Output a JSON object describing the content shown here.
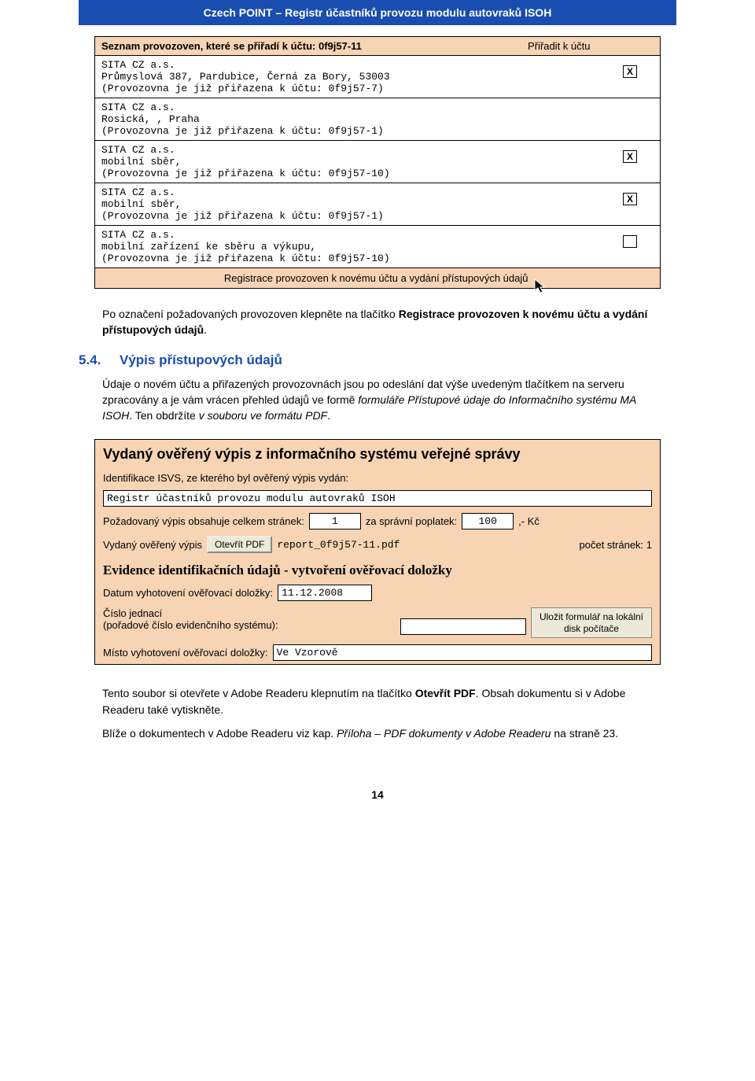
{
  "header": "Czech POINT – Registr účastníků provozu modulu autovraků ISOH",
  "form1": {
    "title_left": "Seznam provozoven, které se přiřadí k účtu: 0f9j57-11",
    "title_right": "Přiřadit k účtu",
    "entries": [
      {
        "line1": "SITA CZ a.s.",
        "line2": "Průmyslová 387, Pardubice, Černá za Bory, 53003",
        "line3": "(Provozovna je již přiřazena k účtu: 0f9j57-7)",
        "checked": true
      },
      {
        "line1": "SITA CZ a.s.",
        "line2": "Rosická, , Praha",
        "line3": "(Provozovna je již přiřazena k účtu: 0f9j57-1)",
        "checked": null
      },
      {
        "line1": "SITA CZ a.s.",
        "line2": "mobilní sběr,",
        "line3": "(Provozovna je již přiřazena k účtu: 0f9j57-10)",
        "checked": true
      },
      {
        "line1": "SITA CZ a.s.",
        "line2": "mobilní sběr,",
        "line3": "(Provozovna je již přiřazena k účtu: 0f9j57-1)",
        "checked": true
      },
      {
        "line1": "SITA CZ a.s.",
        "line2": "mobilní zařízení ke sběru a výkupu,",
        "line3": "(Provozovna je již přiřazena k účtu: 0f9j57-10)",
        "checked": false
      }
    ],
    "footer": "Registrace provozoven k novému účtu a vydání přístupových údajů"
  },
  "para1a": "Po označení požadovaných provozoven klepněte na tlačítko ",
  "para1b": "Registrace provozoven k novému účtu a vydání přístupových údajů",
  "para1c": ".",
  "section_num": "5.4.",
  "section_title": "Výpis přístupových údajů",
  "para2a": "Údaje o novém účtu a přiřazených provozovnách jsou po odeslání dat výše uvedeným tlačítkem na serveru zpracovány a je vám vrácen přehled údajů ve formě ",
  "para2b": "formuláře Přístupové údaje do Informačního systému MA ISOH",
  "para2c": ". Ten obdržíte ",
  "para2d": "v souboru ve formátu PDF",
  "para2e": ".",
  "form2": {
    "hdr": "Vydaný ověřený výpis z informačního systému veřejné správy",
    "ident_label": "Identifikace ISVS, ze kterého byl ověřený výpis vydán:",
    "ident_value": "Registr účastníků provozu modulu autovraků ISOH",
    "pages_label_a": "Požadovaný výpis obsahuje celkem stránek:",
    "pages_value": "1",
    "fee_label": "za správní poplatek:",
    "fee_value": "100",
    "fee_suffix": ",- Kč",
    "issued_label": "Vydaný ověřený výpis",
    "open_pdf_btn": "Otevřít PDF",
    "pdf_name": "report_0f9j57-11.pdf",
    "pages2_label": "počet stránek: 1",
    "subhdr": "Evidence identifikačních údajů - vytvoření ověřovací doložky",
    "date_label": "Datum vyhotovení ověřovací doložky:",
    "date_value": "11.12.2008",
    "cj_label1": "Číslo jednací",
    "cj_label2": "(pořadové číslo evidenčního systému):",
    "save_btn_l1": "Uložit formulář na lokální",
    "save_btn_l2": "disk počítače",
    "place_label": "Místo vyhotovení ověřovací doložky:",
    "place_value": "Ve Vzorově"
  },
  "para3a": "Tento soubor si otevřete v Adobe Readeru klepnutím na tlačítko ",
  "para3b": "Otevřít PDF",
  "para3c": ". Obsah dokumentu si v Adobe Readeru také vytiskněte.",
  "para4a": "Blíže o dokumentech v Adobe Readeru viz kap. ",
  "para4b": "Příloha – PDF dokumenty v Adobe Readeru",
  "para4c": " na straně 23.",
  "page_number": "14"
}
